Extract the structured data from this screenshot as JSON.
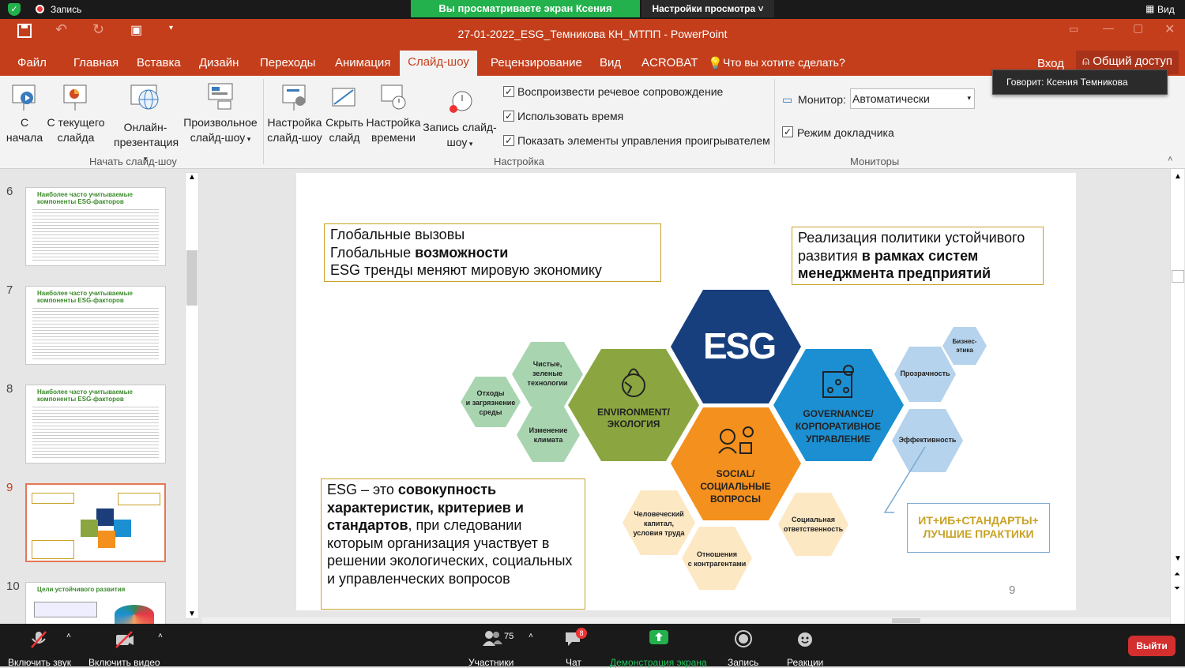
{
  "zoom_top": {
    "recording": "Запись",
    "sharing_banner": "Вы просматриваете экран Ксения Темникова",
    "view_settings": "Настройки просмотра",
    "view_button": "Вид"
  },
  "window": {
    "title": "27-01-2022_ESG_Темникова КН_МТПП - PowerPoint"
  },
  "menu": {
    "file": "Файл",
    "home": "Главная",
    "insert": "Вставка",
    "design": "Дизайн",
    "transitions": "Переходы",
    "animation": "Анимация",
    "slideshow": "Слайд-шоу",
    "review": "Рецензирование",
    "view": "Вид",
    "acrobat": "ACROBAT",
    "tell_me": "Что вы хотите сделать?",
    "login": "Вход",
    "share": "Общий доступ"
  },
  "tooltip": {
    "speaking": "Говорит: Ксения Темникова"
  },
  "ribbon": {
    "from_beginning": "С\nначала",
    "from_current": "С текущего\nслайда",
    "online": "Онлайн-\nпрезентация",
    "custom": "Произвольное\nслайд-шоу",
    "group_start": "Начать слайд-шоу",
    "setup": "Настройка\nслайд-шоу",
    "hide": "Скрыть\nслайд",
    "timing": "Настройка\nвремени",
    "record": "Запись слайд-\nшоу",
    "chk_narration": "Воспроизвести речевое сопровождение",
    "chk_timings": "Использовать время",
    "chk_controls": "Показать элементы управления проигрывателем",
    "group_setup": "Настройка",
    "monitor_label": "Монитор:",
    "monitor_value": "Автоматически",
    "chk_presenter": "Режим докладчика",
    "group_monitors": "Мониторы"
  },
  "thumbnails": [
    {
      "num": "6",
      "title": "Наиболее часто учитываемые\nкомпоненты ESG-факторов"
    },
    {
      "num": "7",
      "title": "Наиболее часто учитываемые\nкомпоненты ESG-факторов"
    },
    {
      "num": "8",
      "title": "Наиболее часто учитываемые\nкомпоненты ESG-факторов"
    },
    {
      "num": "9",
      "title": ""
    },
    {
      "num": "10",
      "title": "Цели устойчивого развития"
    }
  ],
  "slide": {
    "page_number": "9",
    "hex_center": "ESG",
    "hex_env": "ENVIRONMENT/\nЭКОЛОГИЯ",
    "hex_gov": "GOVERNANCE/\nКОРПОРАТИВНОЕ\nУПРАВЛЕНИЕ",
    "hex_social": "SOCIAL/\nСОЦИАЛЬНЫЕ\nВОПРОСЫ",
    "hex_clean": "Чистые,\nзеленые\nтехнологии",
    "hex_waste": "Отходы\nи загрязнение\nсреды",
    "hex_climate": "Изменение\nклимата",
    "hex_ethics": "Бизнес-\nэтика",
    "hex_transparency": "Прозрачность",
    "hex_efficiency": "Эффективность",
    "hex_human": "Человеческий\nкапитал,\nусловия труда",
    "hex_csr": "Социальная\nответственность",
    "hex_relations": "Отношения\nс контрагентами",
    "it_box": "ИТ+ИБ+СТАНДАРТЫ+\nЛУЧШИЕ ПРАКТИКИ"
  },
  "zoom_bottom": {
    "mute": "Включить звук",
    "video": "Включить видео",
    "participants": "Участники",
    "participants_count": "75",
    "chat": "Чат",
    "chat_badge": "8",
    "share": "Демонстрация экрана",
    "record": "Запись",
    "reactions": "Реакции",
    "leave": "Выйти"
  }
}
